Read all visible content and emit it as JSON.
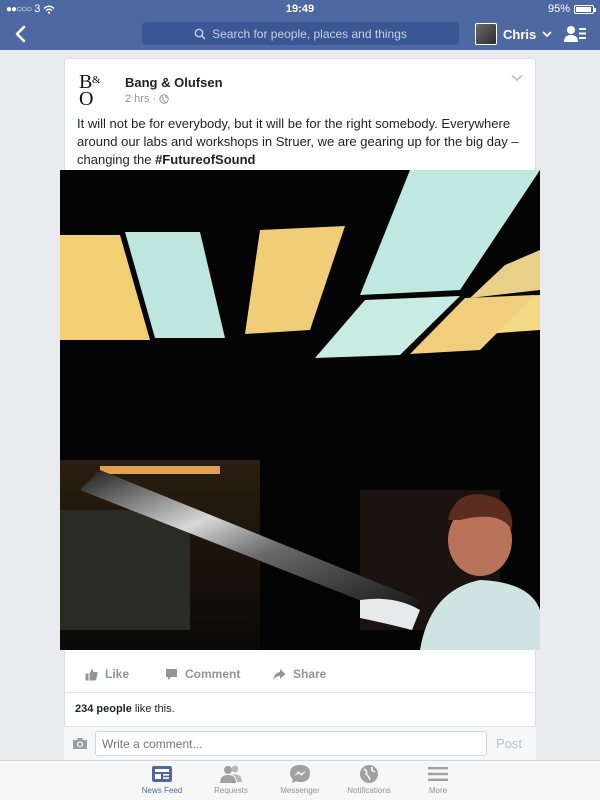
{
  "status": {
    "carrier": "3",
    "time": "19:49",
    "battery": "95%"
  },
  "nav": {
    "search_placeholder": "Search for people, places and things",
    "profile_name": "Chris"
  },
  "post": {
    "page_name": "Bang & Olufsen",
    "time_label": "2 hrs ·",
    "text_plain": "It will not be for everybody, but it will be for the right somebody. Everywhere around our labs and workshops in Struer, we are gearing up for the big day – changing the ",
    "hashtag": "#FutureofSound",
    "actions": {
      "like": "Like",
      "comment": "Comment",
      "share": "Share"
    },
    "likes_count": "234 people",
    "likes_suffix": " like this."
  },
  "comment": {
    "placeholder": "Write a comment...",
    "post_label": "Post"
  },
  "tabs": [
    {
      "label": "News Feed"
    },
    {
      "label": "Requests"
    },
    {
      "label": "Messenger"
    },
    {
      "label": "Notifications"
    },
    {
      "label": "More"
    }
  ],
  "colors": {
    "brand_blue": "#4e69a2",
    "search_bg": "#3b5694",
    "muted": "#90949c"
  }
}
